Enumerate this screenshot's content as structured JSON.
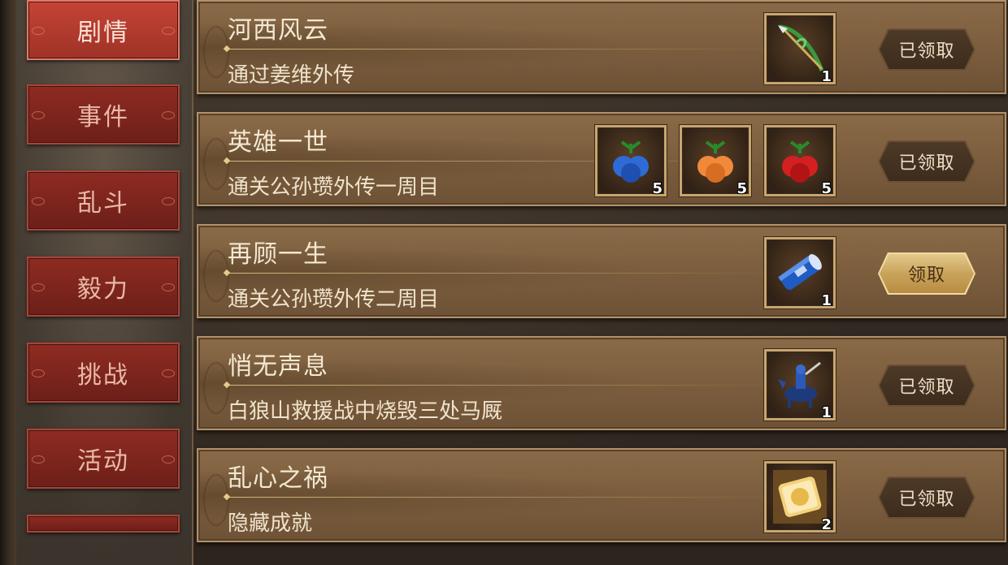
{
  "sidebar": {
    "tabs": [
      {
        "label": "剧情",
        "active": true
      },
      {
        "label": "事件",
        "active": false
      },
      {
        "label": "乱斗",
        "active": false
      },
      {
        "label": "毅力",
        "active": false
      },
      {
        "label": "挑战",
        "active": false
      },
      {
        "label": "活动",
        "active": false
      },
      {
        "label": "",
        "active": false
      }
    ]
  },
  "achievements": [
    {
      "title": "河西风云",
      "desc": "通过姜维外传",
      "rewards": [
        {
          "icon": "spear-icon",
          "count": "1"
        }
      ],
      "button": "已领取",
      "claimed": true
    },
    {
      "title": "英雄一世",
      "desc": "通关公孙瓒外传一周目",
      "rewards": [
        {
          "icon": "blue-fruit-icon",
          "count": "5",
          "color": "#2f6bd6"
        },
        {
          "icon": "orange-fruit-icon",
          "count": "5",
          "color": "#f08a3a"
        },
        {
          "icon": "red-fruit-icon",
          "count": "5",
          "color": "#d42020"
        }
      ],
      "button": "已领取",
      "claimed": true
    },
    {
      "title": "再顾一生",
      "desc": "通关公孙瓒外传二周目",
      "rewards": [
        {
          "icon": "scroll-icon",
          "count": "1"
        }
      ],
      "button": "领取",
      "claimed": false
    },
    {
      "title": "悄无声息",
      "desc": "白狼山救援战中烧毁三处马厩",
      "rewards": [
        {
          "icon": "horseman-icon",
          "count": "1"
        }
      ],
      "button": "已领取",
      "claimed": true
    },
    {
      "title": "乱心之祸",
      "desc": "隐藏成就",
      "rewards": [
        {
          "icon": "gold-token-icon",
          "count": "2"
        }
      ],
      "button": "已领取",
      "claimed": true
    }
  ]
}
